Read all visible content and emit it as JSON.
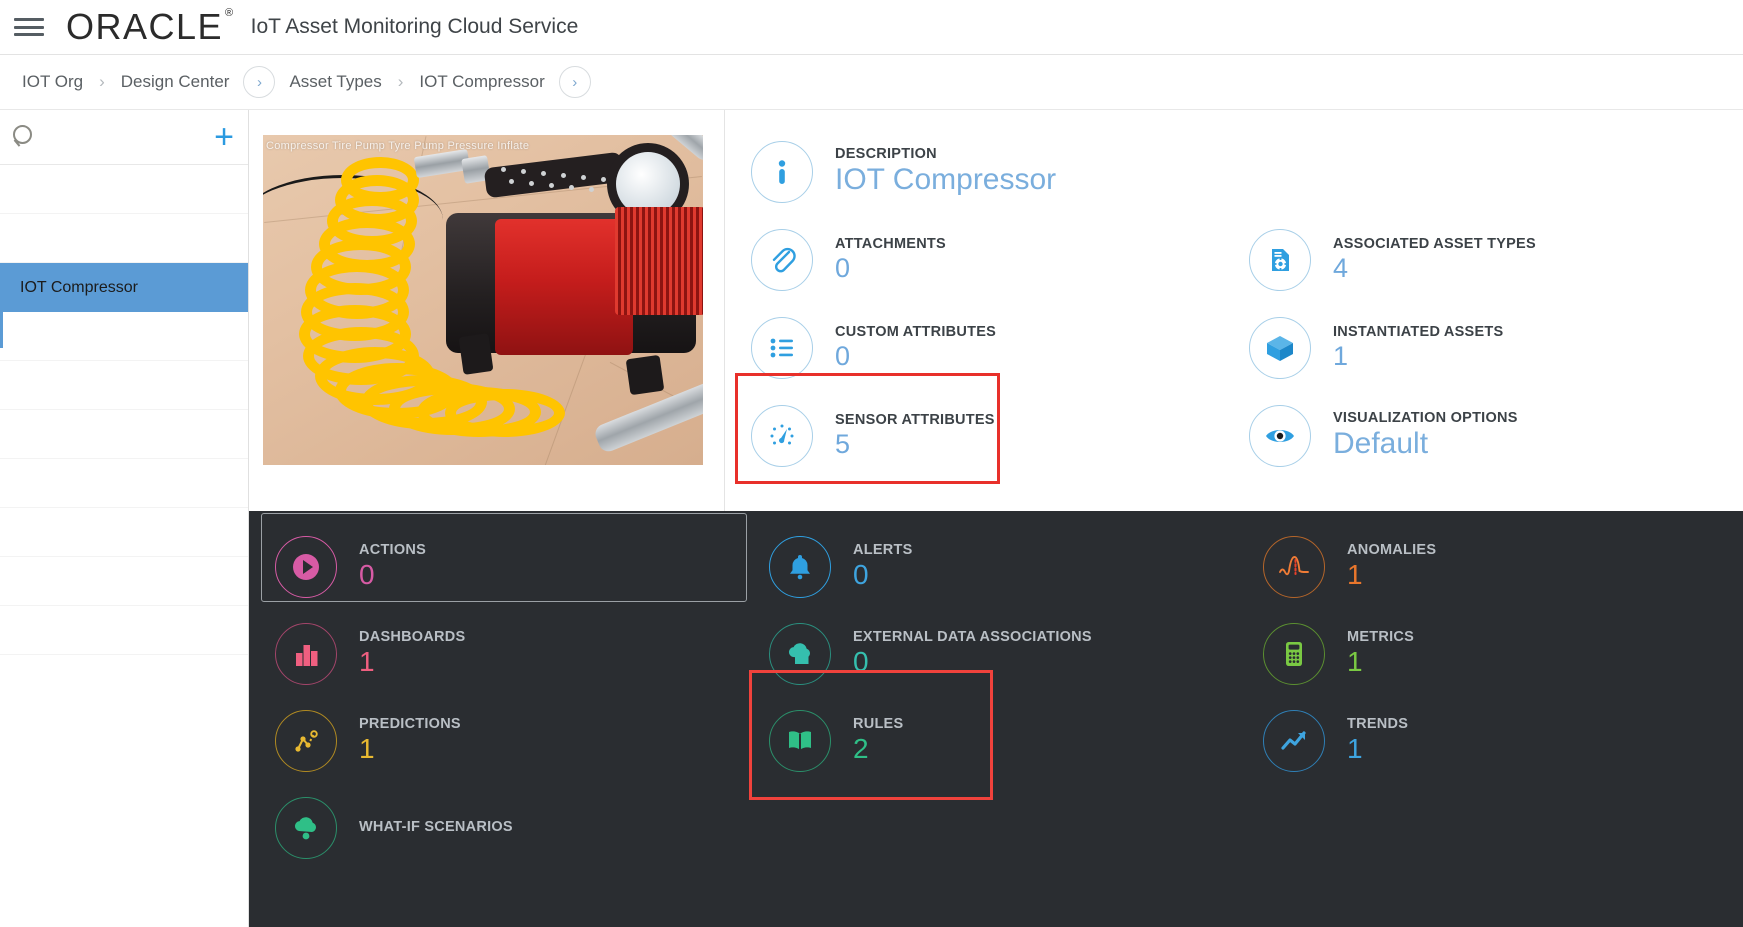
{
  "header": {
    "menu_icon": "hamburger-icon",
    "brand": "ORACLE",
    "brand_mark": "®",
    "app_title": "IoT Asset Monitoring Cloud Service"
  },
  "breadcrumb": {
    "items": [
      {
        "label": "IOT Org",
        "sep": "chevron"
      },
      {
        "label": "Design Center",
        "sep": "circle-chevron"
      },
      {
        "label": "Asset Types",
        "sep": "chevron"
      },
      {
        "label": "IOT Compressor",
        "sep": "circle-chevron"
      }
    ],
    "sep_glyph": "›"
  },
  "sidebar": {
    "search_icon": "search-icon",
    "search_placeholder": "",
    "add_icon": "plus-icon",
    "add_label": "+",
    "items": [
      {
        "label": "IOT Compressor",
        "selected": true
      }
    ],
    "blank_rows": 7
  },
  "asset_image": {
    "alt": "IOT Compressor",
    "watermark": "Compressor  Tire Pump  Tyre Pump  Pressure  Inflate"
  },
  "info_cards": [
    {
      "icon": "info-icon",
      "label": "DESCRIPTION",
      "value": "IOT Compressor",
      "big": true,
      "highlighted": false,
      "col": 1
    },
    {
      "icon": "paperclip-icon",
      "label": "ATTACHMENTS",
      "value": "0",
      "big": false,
      "highlighted": false,
      "col": 1
    },
    {
      "icon": "list-icon",
      "label": "CUSTOM ATTRIBUTES",
      "value": "0",
      "big": false,
      "highlighted": false,
      "col": 1
    },
    {
      "icon": "gauge-icon",
      "label": "SENSOR ATTRIBUTES",
      "value": "5",
      "big": false,
      "highlighted": true,
      "col": 1
    },
    {
      "icon": "document-gear-icon",
      "label": "ASSOCIATED ASSET TYPES",
      "value": "4",
      "big": false,
      "highlighted": false,
      "col": 2
    },
    {
      "icon": "cube-icon",
      "label": "INSTANTIATED ASSETS",
      "value": "1",
      "big": false,
      "highlighted": false,
      "col": 2
    },
    {
      "icon": "eye-icon",
      "label": "VISUALIZATION OPTIONS",
      "value": "Default",
      "big": true,
      "highlighted": false,
      "col": 2
    }
  ],
  "dark_tiles": [
    {
      "icon": "play-circle-icon",
      "label": "ACTIONS",
      "value": "0",
      "color": "#d75ba5",
      "value_color": "#d75ba5",
      "boxed": true,
      "highlighted": false
    },
    {
      "icon": "bell-icon",
      "label": "ALERTS",
      "value": "0",
      "color": "#2f9fe0",
      "value_color": "#3ea4df",
      "boxed": false,
      "highlighted": false
    },
    {
      "icon": "anomaly-icon",
      "label": "ANOMALIES",
      "value": "1",
      "color": "#e8762c",
      "value_color": "#e8762c",
      "boxed": false,
      "highlighted": false
    },
    {
      "icon": "bar-chart-icon",
      "label": "DASHBOARDS",
      "value": "1",
      "color": "#ef5f80",
      "value_color": "#ef5f80",
      "boxed": false,
      "highlighted": false
    },
    {
      "icon": "cloud-folder-icon",
      "label": "EXTERNAL DATA ASSOCIATIONS",
      "value": "0",
      "color": "#35bfae",
      "value_color": "#35bfae",
      "boxed": false,
      "highlighted": false
    },
    {
      "icon": "calculator-icon",
      "label": "METRICS",
      "value": "1",
      "color": "#7ac943",
      "value_color": "#7ac943",
      "boxed": false,
      "highlighted": false
    },
    {
      "icon": "prediction-icon",
      "label": "PREDICTIONS",
      "value": "1",
      "color": "#e8b931",
      "value_color": "#e8b931",
      "boxed": false,
      "highlighted": false
    },
    {
      "icon": "book-icon",
      "label": "RULES",
      "value": "2",
      "color": "#2fbf87",
      "value_color": "#2fbf87",
      "boxed": false,
      "highlighted": true
    },
    {
      "icon": "trend-up-icon",
      "label": "TRENDS",
      "value": "1",
      "color": "#2f9fe0",
      "value_color": "#3ea4df",
      "boxed": false,
      "highlighted": false
    },
    {
      "icon": "whatif-icon",
      "label": "WHAT-IF SCENARIOS",
      "value": "",
      "color": "#2fbf87",
      "value_color": "#2fbf87",
      "boxed": false,
      "highlighted": false
    }
  ],
  "colors": {
    "accent_blue": "#2b9ae0",
    "sidebar_selected": "#5b9bd5",
    "dark_panel_bg": "#2a2d31",
    "highlight_red": "#e8302a",
    "info_value_blue": "#6fa8dc"
  }
}
